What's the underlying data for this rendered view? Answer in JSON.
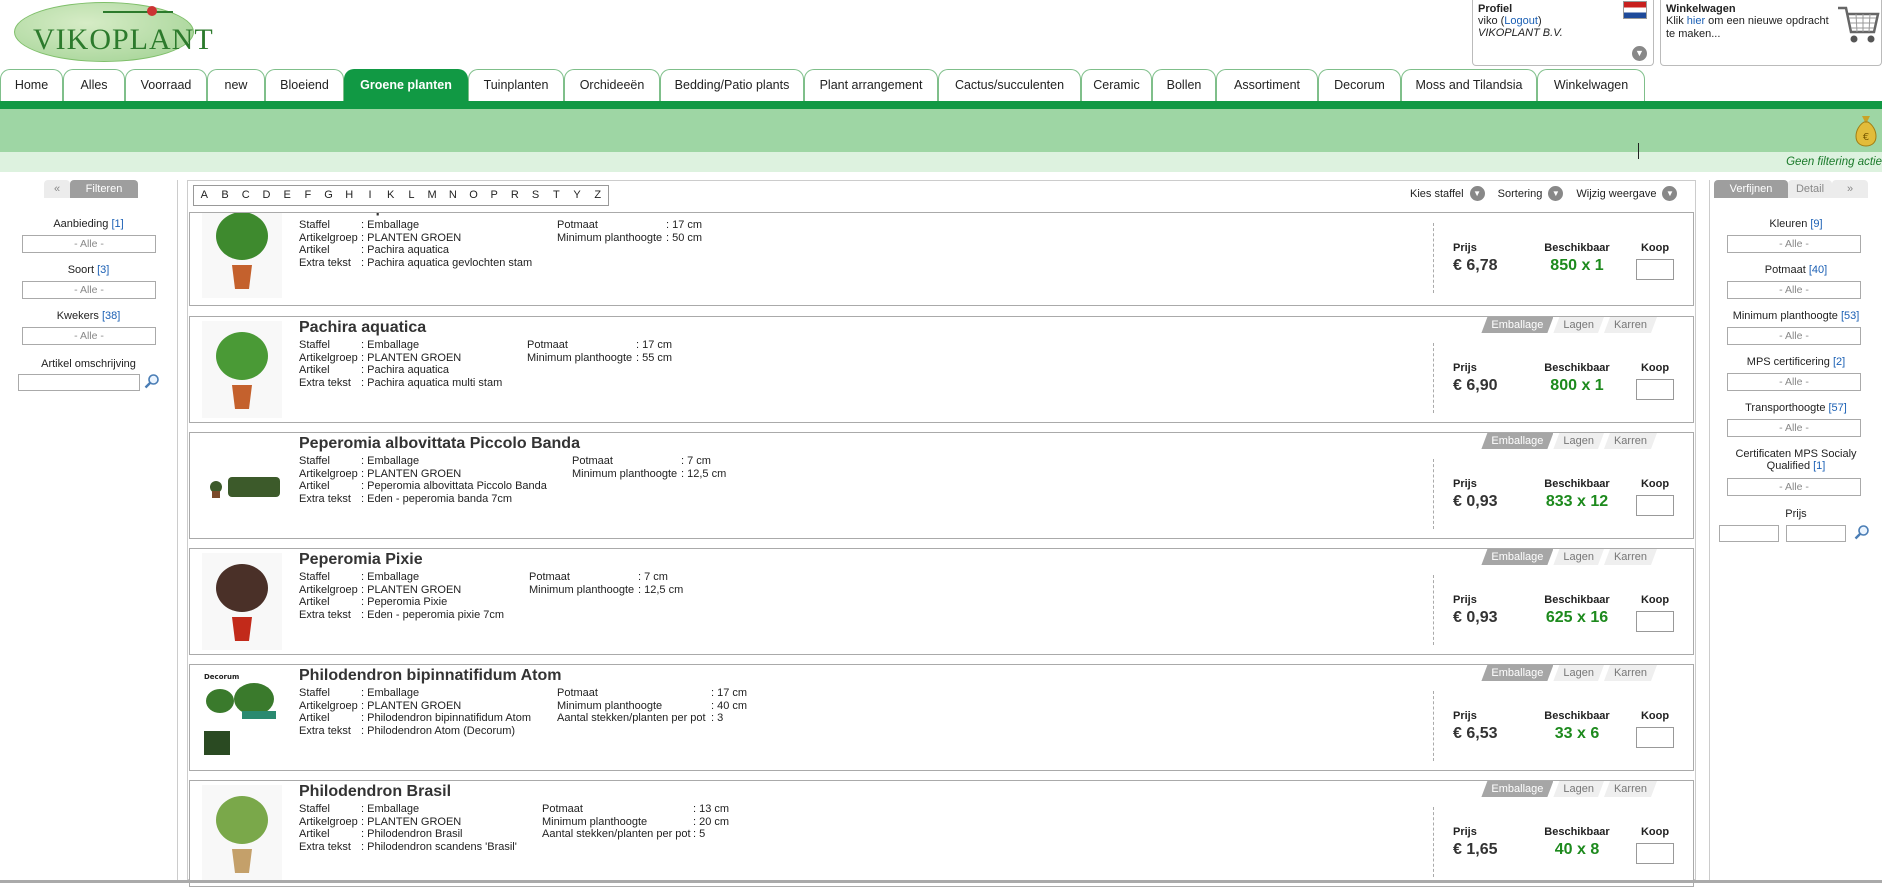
{
  "logo": {
    "text": "VIKOPLANT"
  },
  "profile": {
    "title": "Profiel",
    "user": "viko",
    "logout_open": "(",
    "logout": "Logout",
    "logout_close": ")",
    "company": "VIKOPLANT B.V."
  },
  "cart": {
    "title": "Winkelwagen",
    "line1_a": "Klik ",
    "line1_link": "hier",
    "line1_b": " om een nieuwe opdracht",
    "line2": "te maken..."
  },
  "tabs": [
    "Home",
    "Alles",
    "Voorraad",
    "new",
    "Bloeiend",
    "Groene planten",
    "Tuinplanten",
    "Orchideeën",
    "Bedding/Patio plants",
    "Plant arrangement",
    "Cactus/succulenten",
    "Ceramic",
    "Bollen",
    "Assortiment",
    "Decorum",
    "Moss and Tilandsia",
    "Winkelwagen"
  ],
  "active_tab": "Groene planten",
  "filter_status": "Geen filtering actie",
  "left_panel": {
    "tab": "Filteren",
    "filters": [
      {
        "label": "Aanbieding",
        "count": "[1]",
        "value": "- Alle -"
      },
      {
        "label": "Soort",
        "count": "[3]",
        "value": "- Alle -"
      },
      {
        "label": "Kwekers",
        "count": "[38]",
        "value": "- Alle -"
      }
    ],
    "search_label": "Artikel omschrijving"
  },
  "right_panel": {
    "tab_on": "Verfijnen",
    "tab_off": "Detail",
    "filters": [
      {
        "label": "Kleuren",
        "count": "[9]",
        "value": "- Alle -"
      },
      {
        "label": "Potmaat",
        "count": "[40]",
        "value": "- Alle -"
      },
      {
        "label": "Minimum planthoogte",
        "count": "[53]",
        "value": "- Alle -"
      },
      {
        "label": "MPS certificering",
        "count": "[2]",
        "value": "- Alle -"
      },
      {
        "label": "Transporthoogte",
        "count": "[57]",
        "value": "- Alle -"
      },
      {
        "label": "Certificaten MPS Socialy",
        "label2": "Qualified",
        "count": "[1]",
        "value": "- Alle -"
      }
    ],
    "price_label": "Prijs"
  },
  "letters": [
    "A",
    "B",
    "C",
    "D",
    "E",
    "F",
    "G",
    "H",
    "I",
    "K",
    "L",
    "M",
    "N",
    "O",
    "P",
    "R",
    "S",
    "T",
    "Y",
    "Z"
  ],
  "toolbar": {
    "staffel": "Kies staffel",
    "sort": "Sortering",
    "view": "Wijzig weergave"
  },
  "labels": {
    "staffel": "Staffel",
    "artikelgroep": "Artikelgroep",
    "artikel": "Artikel",
    "extra": "Extra tekst",
    "potmaat": "Potmaat",
    "min_hoogte": "Minimum planthoogte",
    "stekken": "Aantal stekken/planten per pot",
    "prijs": "Prijs",
    "beschikbaar": "Beschikbaar",
    "koop": "Koop",
    "emballage": "Emballage",
    "lagen": "Lagen",
    "karren": "Karren"
  },
  "products": [
    {
      "name": "Pachira aquatica",
      "staffel": ": Emballage",
      "groep": ": PLANTEN GROEN",
      "artikel": ": Pachira aquatica",
      "extra": ": Pachira aquatica gevlochten stam",
      "potmaat": ": 17 cm",
      "hoogte": ": 50 cm",
      "stekken": "",
      "price": "€ 6,78",
      "avail": "850 x 1"
    },
    {
      "name": "Pachira aquatica",
      "staffel": ": Emballage",
      "groep": ": PLANTEN GROEN",
      "artikel": ": Pachira aquatica",
      "extra": ": Pachira aquatica multi stam",
      "potmaat": ": 17 cm",
      "hoogte": ": 55 cm",
      "stekken": "",
      "price": "€ 6,90",
      "avail": "800 x 1"
    },
    {
      "name": "Peperomia albovittata Piccolo Banda",
      "staffel": ": Emballage",
      "groep": ": PLANTEN GROEN",
      "artikel": ": Peperomia albovittata Piccolo Banda",
      "extra": ": Eden - peperomia banda 7cm",
      "potmaat": ": 7 cm",
      "hoogte": ": 12,5 cm",
      "stekken": "",
      "price": "€ 0,93",
      "avail": "833 x 12"
    },
    {
      "name": "Peperomia Pixie",
      "staffel": ": Emballage",
      "groep": ": PLANTEN GROEN",
      "artikel": ": Peperomia Pixie",
      "extra": ": Eden - peperomia pixie 7cm",
      "potmaat": ": 7 cm",
      "hoogte": ": 12,5 cm",
      "stekken": "",
      "price": "€ 0,93",
      "avail": "625 x 16"
    },
    {
      "name": "Philodendron bipinnatifidum Atom",
      "staffel": ": Emballage",
      "groep": ": PLANTEN GROEN",
      "artikel": ": Philodendron bipinnatifidum Atom",
      "extra": ": Philodendron Atom (Decorum)",
      "potmaat": ": 17 cm",
      "hoogte": ": 40 cm",
      "stekken": ": 3",
      "price": "€ 6,53",
      "avail": "33 x 6",
      "brand": "Decorum"
    },
    {
      "name": "Philodendron Brasil",
      "staffel": ": Emballage",
      "groep": ": PLANTEN GROEN",
      "artikel": ": Philodendron Brasil",
      "extra": ": Philodendron scandens 'Brasil'",
      "potmaat": ": 13 cm",
      "hoogte": ": 20 cm",
      "stekken": ": 5",
      "price": "€ 1,65",
      "avail": "40 x 8"
    }
  ],
  "colors": {
    "accent": "#119944",
    "band": "#9ed6a4",
    "available": "#1d8a1d",
    "link": "#1a5fb4"
  }
}
